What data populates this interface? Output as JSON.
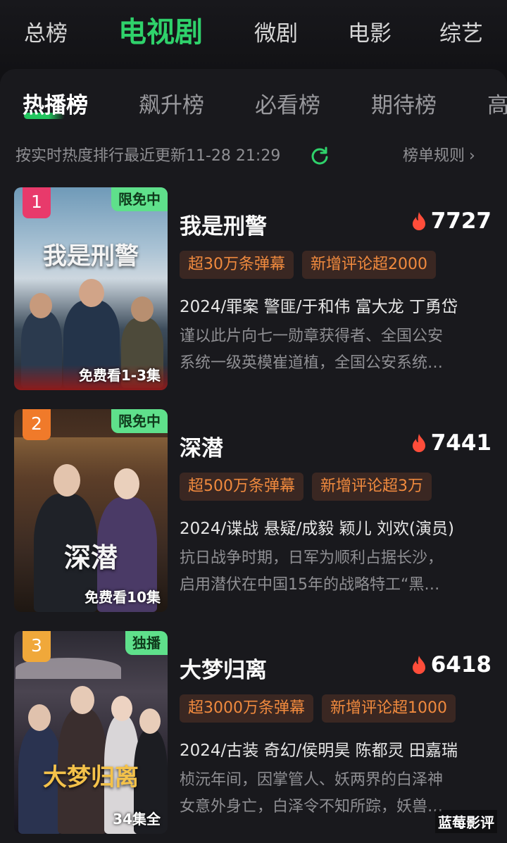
{
  "categories": [
    "总榜",
    "电视剧",
    "微剧",
    "电影",
    "综艺"
  ],
  "subtabs": [
    "热播榜",
    "飙升榜",
    "必看榜",
    "期待榜",
    "高"
  ],
  "updated_text": "按实时热度排行最近更新11-28 21:29",
  "rules_label": "榜单规则",
  "colors": {
    "accent": "#2fd26b",
    "chip_bg": "#3a2722",
    "chip_text": "#f08a3e",
    "heat_icon": "#ff4d3a"
  },
  "items": [
    {
      "rank": "1",
      "rank_color": "#e83a6b",
      "tag": "限免中",
      "poster_title": "我是刑警",
      "episode_label": "免费看1-3集",
      "title": "我是刑警",
      "heat": "7727",
      "chips": [
        "超30万条弹幕",
        "新增评论超2000"
      ],
      "meta": "2024/罪案 警匪/于和伟 富大龙 丁勇岱",
      "desc_line1": "谨以此片向七一勋章获得者、全国公安",
      "desc_line2": "系统一级英模崔道植，全国公安系统…"
    },
    {
      "rank": "2",
      "rank_color": "#f07a2a",
      "tag": "限免中",
      "poster_title": "深潜",
      "episode_label": "免费看10集",
      "title": "深潜",
      "heat": "7441",
      "chips": [
        "超500万条弹幕",
        "新增评论超3万"
      ],
      "meta": "2024/谍战 悬疑/成毅 颖儿 刘欢(演员)",
      "desc_line1": "抗日战争时期，日军为顺利占据长沙，",
      "desc_line2": "启用潜伏在中国15年的战略特工“黑…"
    },
    {
      "rank": "3",
      "rank_color": "#f0a83a",
      "tag": "独播",
      "poster_title": "大梦归离",
      "episode_label": "34集全",
      "title": "大梦归离",
      "heat": "6418",
      "chips": [
        "超3000万条弹幕",
        "新增评论超1000"
      ],
      "meta": "2024/古装 奇幻/侯明昊 陈都灵 田嘉瑞",
      "desc_line1": "桢沅年间，因掌管人、妖两界的白泽神",
      "desc_line2": "女意外身亡，白泽令不知所踪，妖兽…"
    }
  ],
  "watermark": "蓝莓影评"
}
